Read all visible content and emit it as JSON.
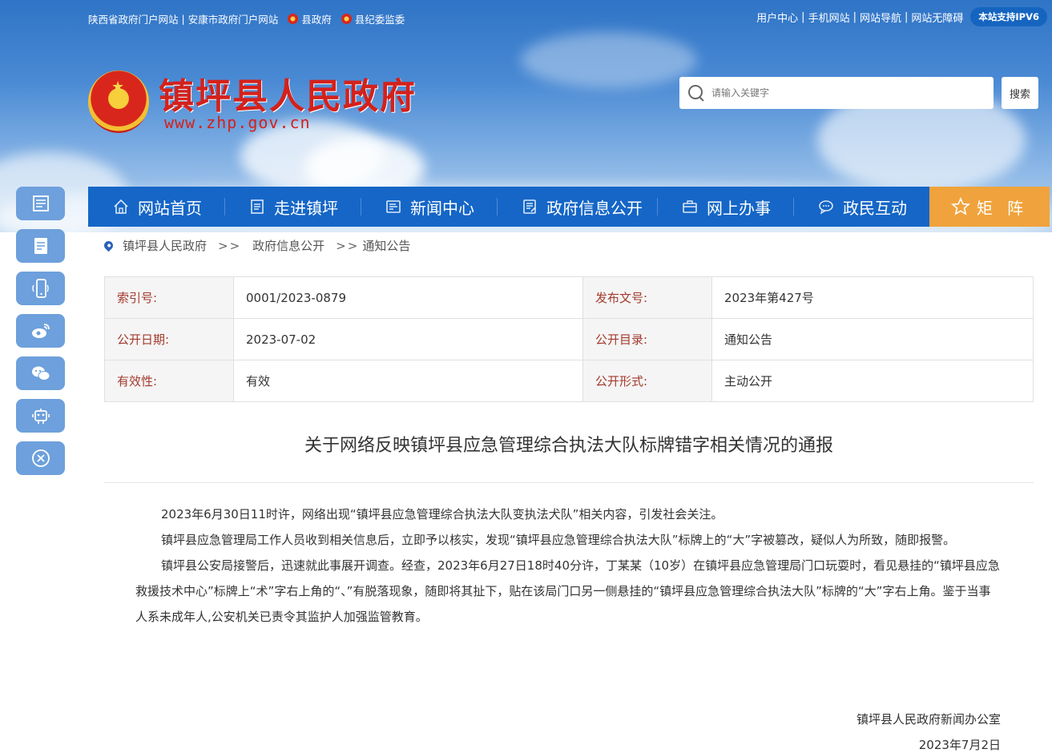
{
  "topbar": {
    "left": [
      "陕西省政府门户网站",
      "安康市政府门户网站",
      "县政府",
      "县纪委监委"
    ],
    "right": [
      "用户中心",
      "手机网站",
      "网站导航",
      "网站无障碍"
    ],
    "ipv6": "本站支持IPV6"
  },
  "logo": {
    "title": "镇坪县人民政府",
    "url": "www.zhp.gov.cn"
  },
  "search": {
    "placeholder": "请输入关键字",
    "button": "搜索"
  },
  "nav": {
    "items": [
      {
        "label": "网站首页",
        "icon": "home-icon"
      },
      {
        "label": "走进镇坪",
        "icon": "document-icon"
      },
      {
        "label": "新闻中心",
        "icon": "news-icon"
      },
      {
        "label": "政府信息公开",
        "icon": "notebook-icon"
      },
      {
        "label": "网上办事",
        "icon": "briefcase-icon"
      },
      {
        "label": "政民互动",
        "icon": "chat-icon"
      }
    ],
    "matrix": "矩 阵"
  },
  "breadcrumb": {
    "root": "镇坪县人民政府",
    "sep": ">>",
    "level1": "政府信息公开",
    "level2": "通知公告"
  },
  "side_icons": [
    "news-list-icon",
    "edit-doc-icon",
    "mobile-icon",
    "weibo-icon",
    "wechat-icon",
    "robot-icon",
    "close-icon"
  ],
  "info": {
    "index_label": "索引号:",
    "index_value": "0001/2023-0879",
    "docno_label": "发布文号:",
    "docno_value": "2023年第427号",
    "date_label": "公开日期:",
    "date_value": "2023-07-02",
    "catalog_label": "公开目录:",
    "catalog_value": "通知公告",
    "valid_label": "有效性:",
    "valid_value": "有效",
    "form_label": "公开形式:",
    "form_value": "主动公开"
  },
  "article": {
    "title": "关于网络反映镇坪县应急管理综合执法大队标牌错字相关情况的通报",
    "paragraphs": [
      "2023年6月30日11时许，网络出现“镇坪县应急管理综合执法大队变执法犬队”相关内容，引发社会关注。",
      "镇坪县应急管理局工作人员收到相关信息后，立即予以核实，发现“镇坪县应急管理综合执法大队”标牌上的“大”字被篡改，疑似人为所致，随即报警。",
      "镇坪县公安局接警后，迅速就此事展开调查。经查，2023年6月27日18时40分许，丁某某（10岁）在镇坪县应急管理局门口玩耍时，看见悬挂的“镇坪县应急救援技术中心”标牌上“术”字右上角的“、”有脱落现象，随即将其扯下，贴在该局门口另一侧悬挂的“镇坪县应急管理综合执法大队”标牌的“大”字右上角。鉴于当事人系未成年人,公安机关已责令其监护人加强监管教育。"
    ],
    "signature": "镇坪县人民政府新闻办公室",
    "date": "2023年7月2日"
  },
  "colors": {
    "nav_bg": "#1566c7",
    "matrix_bg": "#f0a33c",
    "logo_red": "#d4211b",
    "label_red": "#a33a2d"
  }
}
